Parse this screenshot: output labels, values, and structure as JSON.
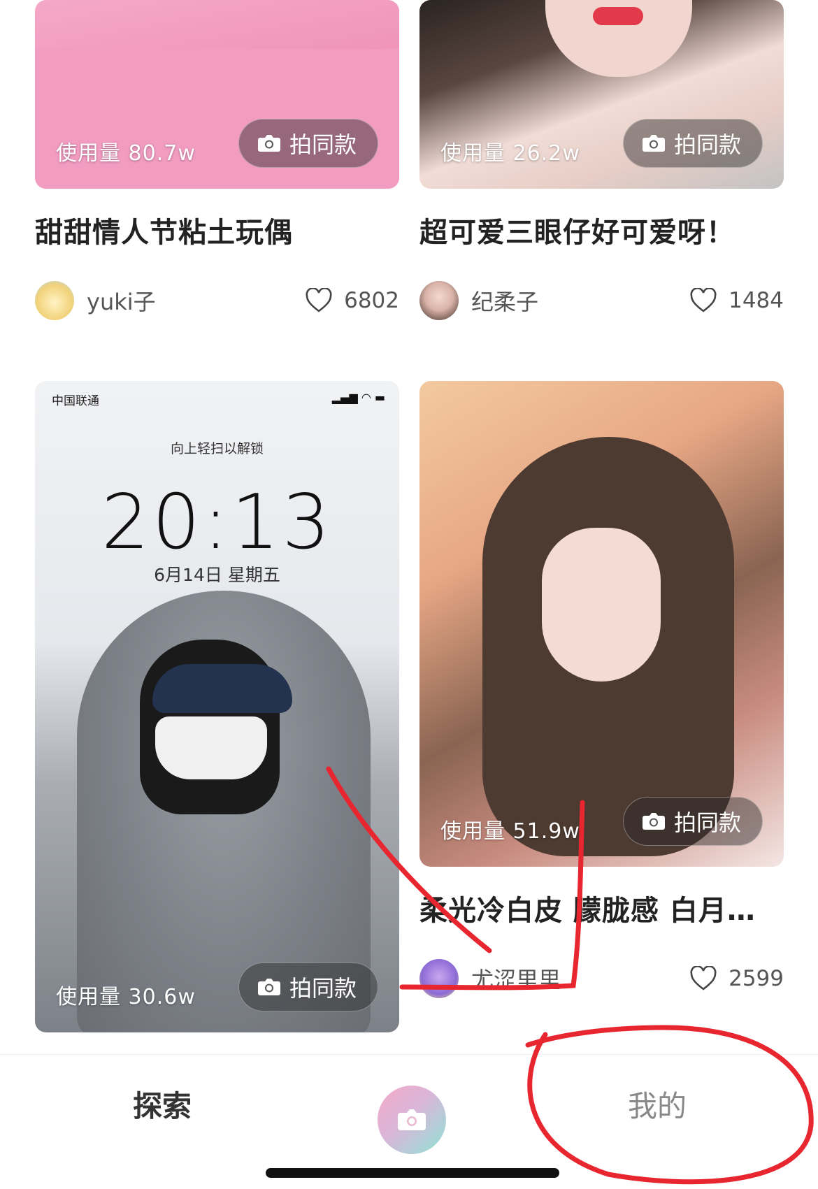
{
  "cards": [
    {
      "usage": "使用量 80.7w",
      "shoot_label": "拍同款",
      "title": "甜甜情人节粘土玩偶",
      "author": "yuki子",
      "likes": "6802"
    },
    {
      "usage": "使用量 26.2w",
      "shoot_label": "拍同款",
      "title": "超可爱三眼仔好可爱呀！",
      "author": "纪柔子",
      "likes": "1484"
    },
    {
      "usage": "使用量 30.6w",
      "shoot_label": "拍同款",
      "lockscreen": {
        "carrier": "中国联通",
        "hint": "向上轻扫以解锁",
        "time": "20:13",
        "date": "6月14日 星期五"
      }
    },
    {
      "usage": "使用量 51.9w",
      "shoot_label": "拍同款",
      "title": "柔光冷白皮 朦胧感 白月…",
      "author": "尤涩里里",
      "likes": "2599"
    }
  ],
  "tabbar": {
    "explore": "探索",
    "mine": "我的",
    "camera_icon": "camera-icon"
  },
  "colors": {
    "annotation_red": "#e8262f",
    "camera_gradient_start": "#f6a9c6",
    "camera_gradient_end": "#8fe3d3"
  }
}
